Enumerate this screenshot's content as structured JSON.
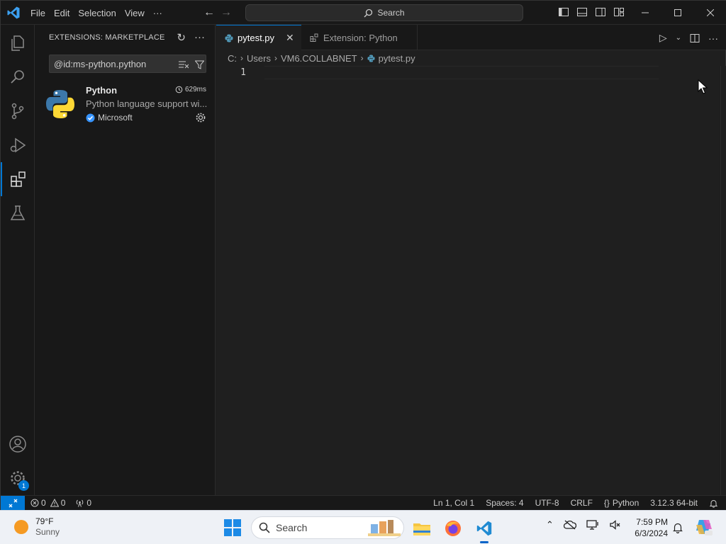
{
  "titlebar": {
    "menu": [
      "File",
      "Edit",
      "Selection",
      "View",
      "···"
    ],
    "command_center": "Search"
  },
  "sidebar": {
    "title": "EXTENSIONS: MARKETPLACE",
    "search_value": "@id:ms-python.python",
    "extension": {
      "name": "Python",
      "time": "629ms",
      "description": "Python language support wi...",
      "publisher": "Microsoft"
    }
  },
  "activity": {
    "accounts_badge": "1"
  },
  "tabs": [
    {
      "label": "pytest.py",
      "active": true
    },
    {
      "label": "Extension: Python",
      "active": false
    }
  ],
  "breadcrumb": [
    "C:",
    "Users",
    "VM6.COLLABNET",
    "pytest.py"
  ],
  "editor": {
    "line_numbers": [
      "1"
    ]
  },
  "statusbar": {
    "errors": "0",
    "warnings": "0",
    "ports": "0",
    "position": "Ln 1, Col 1",
    "spaces": "Spaces: 4",
    "encoding": "UTF-8",
    "eol": "CRLF",
    "language": "Python",
    "interpreter": "3.12.3 64-bit"
  },
  "taskbar": {
    "weather_temp": "79°F",
    "weather_desc": "Sunny",
    "search_placeholder": "Search",
    "time": "7:59 PM",
    "date": "6/3/2024"
  },
  "colors": {
    "accent": "#0078d4",
    "editor_bg": "#1f1f1f",
    "panel_bg": "#181818"
  }
}
